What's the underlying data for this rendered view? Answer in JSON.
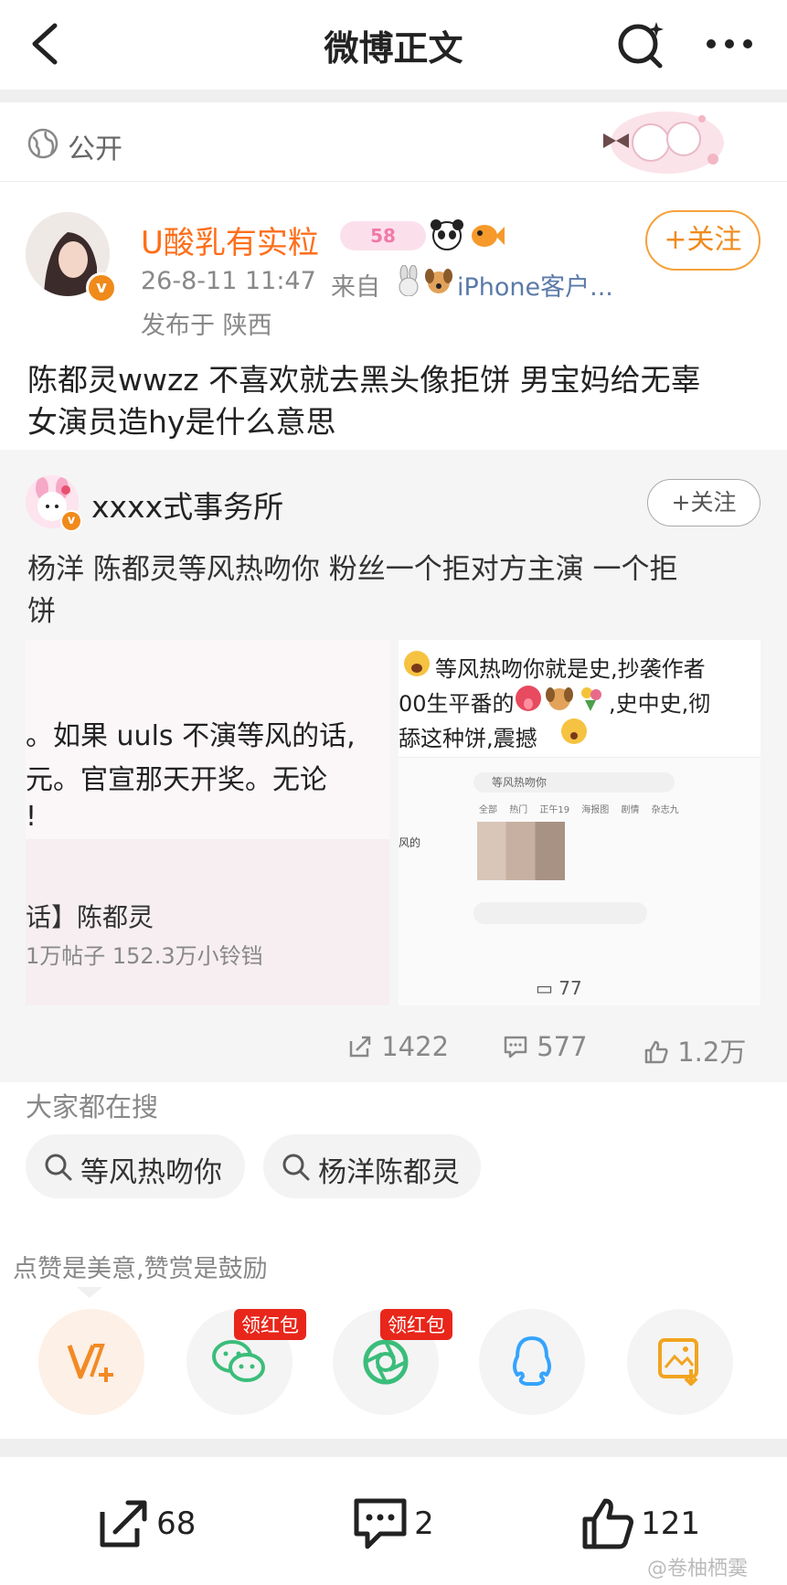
{
  "header": {
    "title": "微博正文"
  },
  "visibility": {
    "label": "公开"
  },
  "post": {
    "author": {
      "name": "U酸乳有实粒",
      "level_badge": "58"
    },
    "time": "26-8-11 11:47",
    "source_prefix": "来自",
    "source": "iPhone客户...",
    "location": "发布于 陕西",
    "follow_label": "+关注",
    "text_line1": "陈都灵wwzz 不喜欢就去黑头像拒饼 男宝妈给无辜",
    "text_line2": "女演员造hy是什么意思"
  },
  "repost": {
    "author": {
      "name": "xxxx式事务所"
    },
    "follow_label": "+关注",
    "text_line1": "杨洋 陈都灵等风热吻你 粉丝一个拒对方主演 一个拒",
    "text_line2": "饼",
    "image1": {
      "line1": "。如果 uuls 不演等风的话,",
      "line2": "元。官宣那天开奖。无论",
      "line3": "!",
      "line4": "话】陈都灵",
      "line5": "1万帖子 152.3万小铃铛"
    },
    "image2": {
      "line1": "等风热吻你就是史,抄袭作者",
      "line2": "00生平番的",
      "line2b": ",史中史,彻",
      "line3": "舔这种饼,震撼",
      "inner_search": "等风热吻你",
      "inner_tabs": [
        "全部",
        "热门",
        "正午19",
        "海报图",
        "剧情",
        "杂志九"
      ],
      "inner_label_left": "风的",
      "inner_comment": "77"
    },
    "stats": {
      "share": "1422",
      "comment": "577",
      "like": "1.2万"
    }
  },
  "search": {
    "title": "大家都在搜",
    "items": [
      "等风热吻你",
      "杨洋陈都灵"
    ]
  },
  "reward": {
    "hint": "点赞是美意,赞赏是鼓励"
  },
  "share_targets": [
    {
      "name": "赞赏",
      "badge": ""
    },
    {
      "name": "微信",
      "badge": "领红包"
    },
    {
      "name": "朋友圈",
      "badge": "领红包"
    },
    {
      "name": "QQ",
      "badge": ""
    },
    {
      "name": "保存图片",
      "badge": ""
    }
  ],
  "bottom": {
    "share": "68",
    "comment": "2",
    "like": "121"
  },
  "watermark": "@卷柚栖霙",
  "colors": {
    "accent": "#ff8200",
    "badge_red": "#e8261a",
    "wechat_green": "#3bbd7a",
    "qq_blue": "#35a4ff"
  }
}
